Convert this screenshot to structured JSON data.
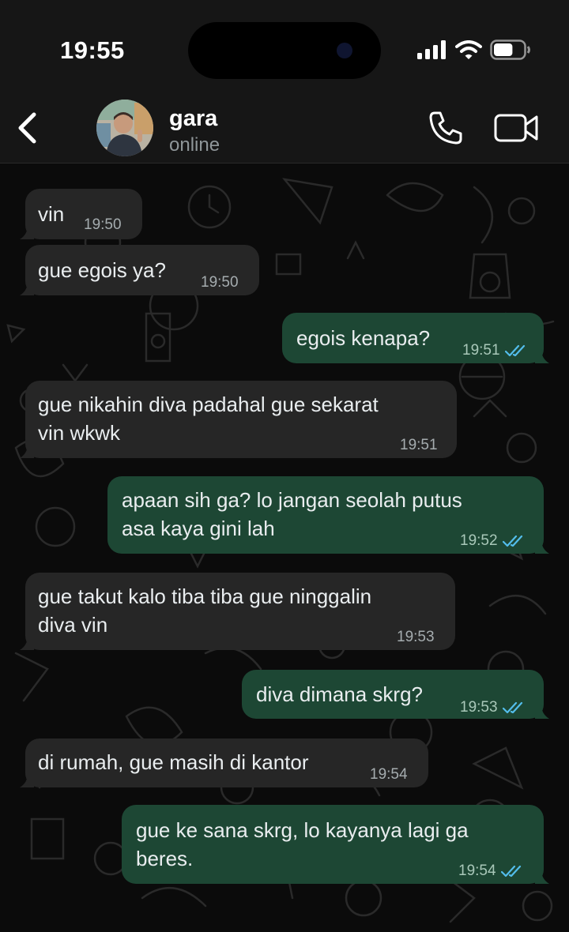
{
  "status_bar": {
    "time": "19:55",
    "battery_percent": 65
  },
  "header": {
    "contact_name": "gara",
    "contact_status": "online"
  },
  "icons": {
    "back": "chevron-left-icon",
    "call": "phone-icon",
    "video": "video-camera-icon",
    "read_receipt": "double-check-icon"
  },
  "colors": {
    "incoming_bubble": "#262626",
    "outgoing_bubble": "#1d4734",
    "read_check": "#53bdeb"
  },
  "messages": [
    {
      "direction": "in",
      "lines": [
        "vin"
      ],
      "time": "19:50"
    },
    {
      "direction": "in",
      "lines": [
        "gue egois ya?"
      ],
      "time": "19:50"
    },
    {
      "direction": "out",
      "lines": [
        "egois kenapa?"
      ],
      "time": "19:51",
      "read": true
    },
    {
      "direction": "in",
      "lines": [
        "gue nikahin diva padahal gue sekarat",
        "vin wkwk"
      ],
      "time": "19:51"
    },
    {
      "direction": "out",
      "lines": [
        "apaan sih ga? lo jangan seolah putus",
        "asa kaya gini lah"
      ],
      "time": "19:52",
      "read": true
    },
    {
      "direction": "in",
      "lines": [
        "gue takut kalo tiba tiba gue ninggalin",
        "diva vin"
      ],
      "time": "19:53"
    },
    {
      "direction": "out",
      "lines": [
        "diva dimana skrg?"
      ],
      "time": "19:53",
      "read": true
    },
    {
      "direction": "in",
      "lines": [
        "di rumah, gue masih di kantor"
      ],
      "time": "19:54"
    },
    {
      "direction": "out",
      "lines": [
        "gue ke sana skrg, lo kayanya lagi ga",
        "beres."
      ],
      "time": "19:54",
      "read": true
    }
  ]
}
